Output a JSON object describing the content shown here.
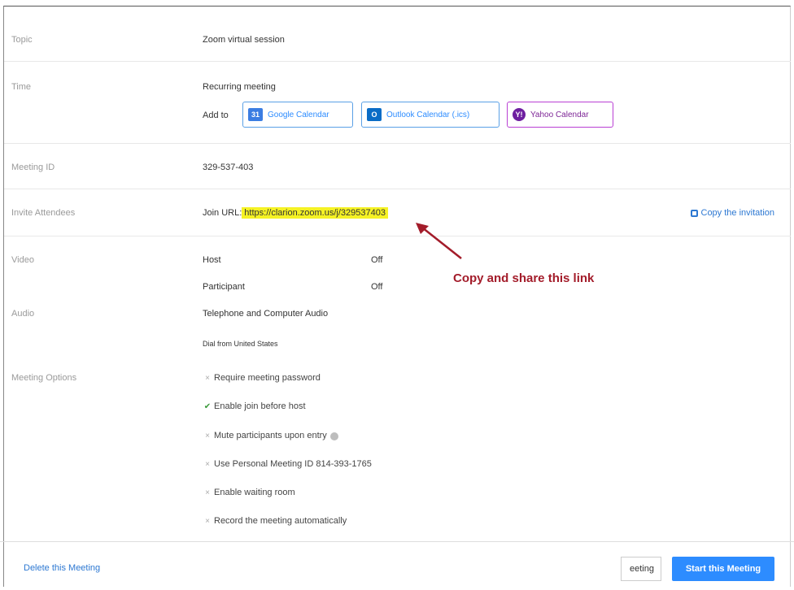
{
  "topic": {
    "label": "Topic",
    "value": "Zoom virtual session"
  },
  "time": {
    "label": "Time",
    "value": "Recurring meeting",
    "add_to": "Add to",
    "google": {
      "icon_text": "31",
      "label": "Google Calendar"
    },
    "outlook": {
      "icon_text": "O",
      "label": "Outlook Calendar (.ics)"
    },
    "yahoo": {
      "icon_text": "Y!",
      "label": "Yahoo Calendar"
    }
  },
  "meeting_id": {
    "label": "Meeting ID",
    "value": "329-537-403"
  },
  "invite": {
    "label": "Invite Attendees",
    "join_label": "Join URL:",
    "join_url": "https://clarion.zoom.us/j/329537403",
    "copy_label": "Copy the invitation"
  },
  "annotation": {
    "text": "Copy and share this link",
    "color": "#a31c2a"
  },
  "video": {
    "label": "Video",
    "host_label": "Host",
    "host_value": "Off",
    "participant_label": "Participant",
    "participant_value": "Off"
  },
  "audio": {
    "label": "Audio",
    "value": "Telephone and Computer Audio",
    "dial": "Dial from United States"
  },
  "options": {
    "label": "Meeting Options",
    "items": [
      {
        "mark": "×",
        "text": "Require meeting password"
      },
      {
        "mark": "✔",
        "text": "Enable join before host"
      },
      {
        "mark": "×",
        "text": "Mute participants upon entry"
      },
      {
        "mark": "×",
        "text": "Use Personal Meeting ID 814-393-1765"
      },
      {
        "mark": "×",
        "text": "Enable waiting room"
      },
      {
        "mark": "×",
        "text": "Record the meeting automatically"
      }
    ]
  },
  "footer": {
    "delete_label": "Delete this Meeting",
    "secondary_label": "eeting",
    "start_label": "Start this Meeting"
  },
  "colors": {
    "accent": "#2d8cff",
    "link": "#2d78d2",
    "highlight": "#f5f224",
    "check": "#3a9a3a"
  }
}
